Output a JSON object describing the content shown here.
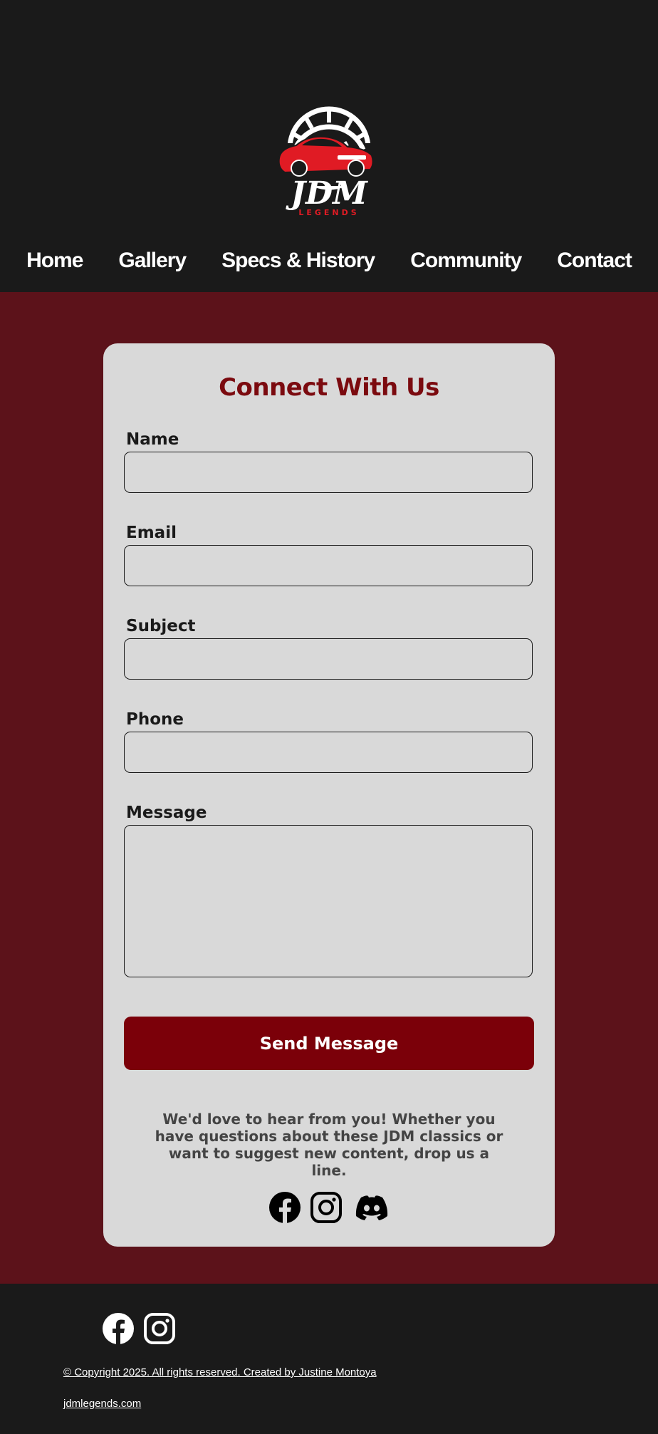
{
  "brand": {
    "logo_word": "JDM",
    "logo_sub": "LEGENDS"
  },
  "nav": {
    "items": [
      {
        "label": "Home"
      },
      {
        "label": "Gallery"
      },
      {
        "label": "Specs & History"
      },
      {
        "label": "Community"
      },
      {
        "label": "Contact"
      }
    ]
  },
  "form": {
    "title": "Connect With Us",
    "name_label": "Name",
    "email_label": "Email",
    "subject_label": "Subject",
    "phone_label": "Phone",
    "message_label": "Message",
    "name_value": "",
    "email_value": "",
    "subject_value": "",
    "phone_value": "",
    "message_value": "",
    "submit_label": "Send Message",
    "note": "We'd love to hear from you! Whether you have questions about these JDM classics or want to suggest new content, drop us a line."
  },
  "social_icons": [
    "facebook-icon",
    "instagram-icon",
    "discord-icon"
  ],
  "footer": {
    "social_icons": [
      "facebook-icon",
      "instagram-icon"
    ],
    "copyright": "© Copyright 2025. All rights reserved. Created by Justine Montoya",
    "site": "jdmlegends.com"
  },
  "colors": {
    "background": "#1a1a1a",
    "main_bg": "#5c121a",
    "card_bg": "#d9d9d9",
    "accent": "#7b0a0f",
    "button": "#7b0009",
    "logo_red": "#e01b24"
  }
}
